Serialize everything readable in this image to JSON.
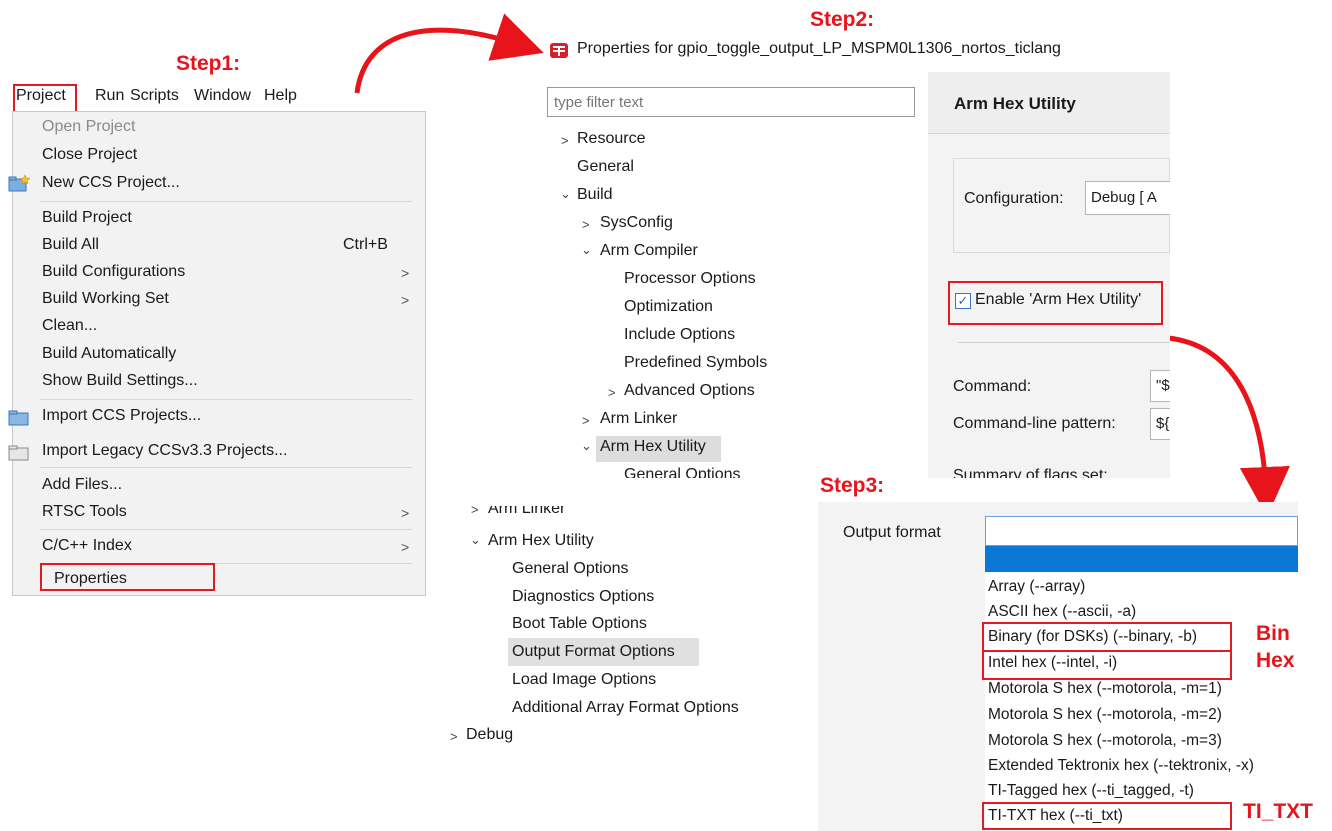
{
  "steps": {
    "step1": "Step1:",
    "step2": "Step2:",
    "step3": "Step3:"
  },
  "menubar": {
    "items": [
      "Project",
      "Run",
      "Scripts",
      "Window",
      "Help"
    ]
  },
  "project_menu": {
    "open_project": "Open Project",
    "close_project": "Close Project",
    "new_ccs_project": "New CCS Project...",
    "build_project": "Build Project",
    "build_all": "Build All",
    "build_all_shortcut": "Ctrl+B",
    "build_configurations": "Build Configurations",
    "build_working_set": "Build Working Set",
    "clean": "Clean...",
    "build_automatically": "Build Automatically",
    "show_build_settings": "Show Build Settings...",
    "import_ccs_projects": "Import CCS Projects...",
    "import_legacy": "Import Legacy CCSv3.3 Projects...",
    "add_files": "Add Files...",
    "rtsc_tools": "RTSC Tools",
    "cc_index": "C/C++ Index",
    "properties": "Properties"
  },
  "properties_dialog": {
    "title": "Properties for gpio_toggle_output_LP_MSPM0L1306_nortos_ticlang",
    "filter_placeholder": "type filter text",
    "tree": {
      "resource": "Resource",
      "general": "General",
      "build": "Build",
      "sysconfig": "SysConfig",
      "arm_compiler": "Arm Compiler",
      "processor_options": "Processor Options",
      "optimization": "Optimization",
      "include_options": "Include Options",
      "predefined_symbols": "Predefined Symbols",
      "advanced_options": "Advanced Options",
      "arm_linker": "Arm Linker",
      "arm_hex_utility": "Arm Hex Utility",
      "general_options": "General Options"
    },
    "page_title": "Arm Hex Utility",
    "configuration_label": "Configuration:",
    "configuration_value": "Debug [ A",
    "enable_label": "Enable 'Arm Hex Utility'",
    "command_label": "Command:",
    "command_value": "\"$",
    "cmd_pattern_label": "Command-line pattern:",
    "cmd_pattern_value": "${",
    "summary_label": "Summary of flags set:"
  },
  "hex_tree": {
    "arm_linker": "Arm Linker",
    "arm_hex_utility": "Arm Hex Utility",
    "general_options": "General Options",
    "diagnostics_options": "Diagnostics Options",
    "boot_table_options": "Boot Table Options",
    "output_format_options": "Output Format Options",
    "load_image_options": "Load Image Options",
    "additional_array_format_options": "Additional Array Format Options",
    "debug": "Debug"
  },
  "output_format": {
    "label": "Output format",
    "options": [
      "Array (--array)",
      "ASCII hex (--ascii, -a)",
      "Binary (for DSKs) (--binary, -b)",
      "Intel hex (--intel, -i)",
      "Motorola S hex (--motorola, -m=1)",
      "Motorola S hex (--motorola, -m=2)",
      "Motorola S hex (--motorola, -m=3)",
      "Extended Tektronix hex (--tektronix, -x)",
      "TI-Tagged hex (--ti_tagged, -t)",
      "TI-TXT hex (--ti_txt)"
    ]
  },
  "annotations": {
    "bin": "Bin",
    "hex": "Hex",
    "ti_txt": "TI_TXT"
  },
  "colors": {
    "accent_red": "#e11b22",
    "selection_blue": "#0b78d6"
  }
}
